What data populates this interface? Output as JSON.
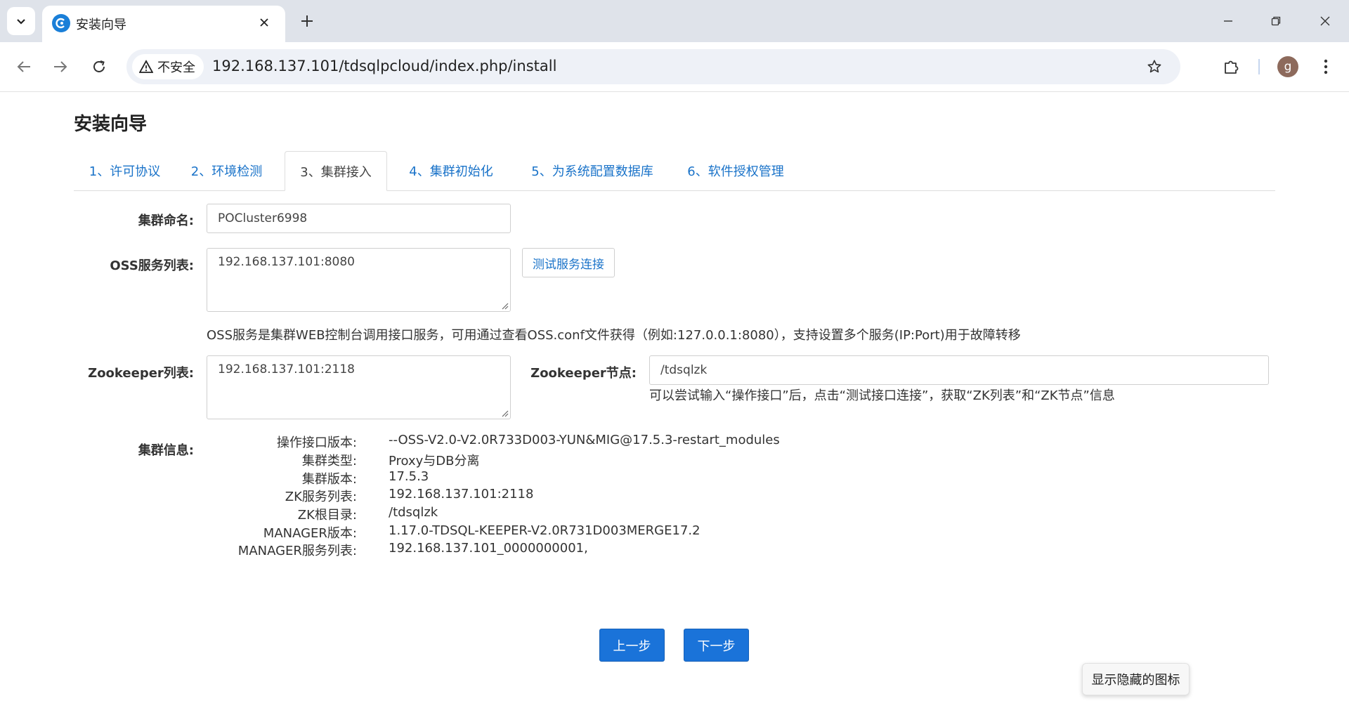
{
  "browser": {
    "tab_title": "安装向导",
    "security_label": "不安全",
    "url": "192.168.137.101/tdsqlpcloud/index.php/install",
    "profile_initial": "g"
  },
  "page": {
    "title": "安装向导",
    "wizard_tabs": [
      {
        "label": "1、许可协议",
        "active": false
      },
      {
        "label": "2、环境检测",
        "active": false
      },
      {
        "label": "3、集群接入",
        "active": true
      },
      {
        "label": "4、集群初始化",
        "active": false
      },
      {
        "label": "5、为系统配置数据库",
        "active": false
      },
      {
        "label": "6、软件授权管理",
        "active": false
      }
    ]
  },
  "form": {
    "cluster_name_label": "集群命名:",
    "cluster_name_value": "POCluster6998",
    "oss_label": "OSS服务列表:",
    "oss_value": "192.168.137.101:8080",
    "test_button_label": "测试服务连接",
    "oss_help": "OSS服务是集群WEB控制台调用接口服务，可用通过查看OSS.conf文件获得（例如:127.0.0.1:8080），支持设置多个服务(IP:Port)用于故障转移",
    "zk_list_label": "Zookeeper列表:",
    "zk_list_value": "192.168.137.101:2118",
    "zk_node_label": "Zookeeper节点:",
    "zk_node_value": "/tdsqlzk",
    "zk_help": "可以尝试输入“操作接口”后，点击“测试接口连接”，获取“ZK列表”和“ZK节点”信息"
  },
  "cluster_info": {
    "label": "集群信息:",
    "rows": [
      {
        "key": "操作接口版本:",
        "value": "--OSS-V2.0-V2.0R733D003-YUN&MIG@17.5.3-restart_modules"
      },
      {
        "key": "集群类型:",
        "value": "Proxy与DB分离"
      },
      {
        "key": "集群版本:",
        "value": "17.5.3"
      },
      {
        "key": "ZK服务列表:",
        "value": "192.168.137.101:2118"
      },
      {
        "key": "ZK根目录:",
        "value": "/tdsqlzk"
      },
      {
        "key": "MANAGER版本:",
        "value": "1.17.0-TDSQL-KEEPER-V2.0R731D003MERGE17.2"
      },
      {
        "key": "MANAGER服务列表:",
        "value": "192.168.137.101_0000000001,"
      }
    ]
  },
  "actions": {
    "prev_label": "上一步",
    "next_label": "下一步"
  },
  "tooltip": {
    "text": "显示隐藏的图标"
  },
  "colors": {
    "accent": "#1a73d9",
    "link": "#1a73c9",
    "chrome_bg": "#dfe3ea"
  }
}
